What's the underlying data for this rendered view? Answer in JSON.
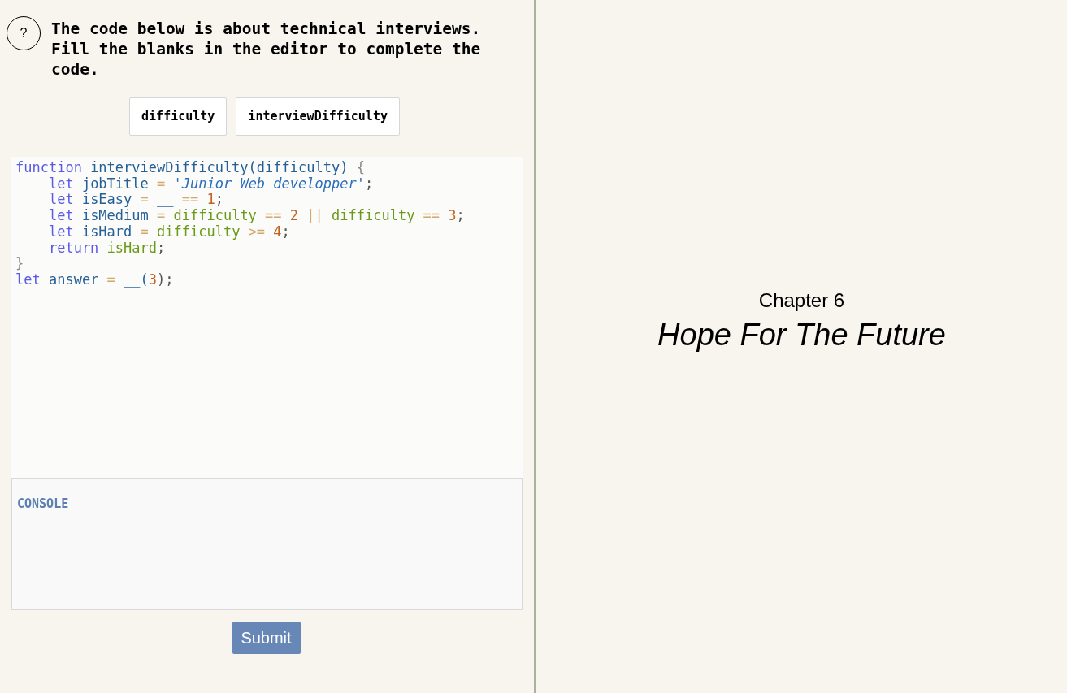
{
  "question": {
    "help_icon": "?",
    "text": "The code below is about technical interviews. Fill the blanks in the editor to complete the code."
  },
  "choices": [
    "difficulty",
    "interviewDifficulty"
  ],
  "code_lines": [
    {
      "tokens": [
        {
          "text": "function",
          "kind": "keyword"
        },
        {
          "text": " interviewDifficulty",
          "kind": "def"
        },
        {
          "text": "(difficulty) ",
          "kind": "def"
        },
        {
          "text": "{",
          "kind": "bracket"
        }
      ]
    },
    {
      "tokens": [
        {
          "text": "    let",
          "kind": "keyword"
        },
        {
          "text": " jobTitle ",
          "kind": "def"
        },
        {
          "text": "=",
          "kind": "operator"
        },
        {
          "text": " '",
          "kind": "string"
        },
        {
          "text": "Junior Web developper",
          "kind": "string-italic"
        },
        {
          "text": "'",
          "kind": "string"
        },
        {
          "text": ";",
          "kind": "punct"
        }
      ]
    },
    {
      "tokens": [
        {
          "text": "    let",
          "kind": "keyword"
        },
        {
          "text": " isEasy ",
          "kind": "def"
        },
        {
          "text": "=",
          "kind": "operator"
        },
        {
          "text": " __",
          "kind": "blank"
        },
        {
          "text": " ==",
          "kind": "operator"
        },
        {
          "text": " 1",
          "kind": "number"
        },
        {
          "text": ";",
          "kind": "punct"
        }
      ]
    },
    {
      "tokens": [
        {
          "text": "    let",
          "kind": "keyword"
        },
        {
          "text": " isMedium ",
          "kind": "def"
        },
        {
          "text": "=",
          "kind": "operator"
        },
        {
          "text": " difficulty",
          "kind": "variable"
        },
        {
          "text": " ==",
          "kind": "operator"
        },
        {
          "text": " 2",
          "kind": "number"
        },
        {
          "text": " ||",
          "kind": "operator"
        },
        {
          "text": " difficulty",
          "kind": "variable"
        },
        {
          "text": " ==",
          "kind": "operator"
        },
        {
          "text": " 3",
          "kind": "number"
        },
        {
          "text": ";",
          "kind": "punct"
        }
      ]
    },
    {
      "tokens": [
        {
          "text": "    let",
          "kind": "keyword"
        },
        {
          "text": " isHard ",
          "kind": "def"
        },
        {
          "text": "=",
          "kind": "operator"
        },
        {
          "text": " difficulty",
          "kind": "variable"
        },
        {
          "text": " >=",
          "kind": "operator"
        },
        {
          "text": " 4",
          "kind": "number"
        },
        {
          "text": ";",
          "kind": "punct"
        }
      ]
    },
    {
      "tokens": [
        {
          "text": "    return",
          "kind": "keyword"
        },
        {
          "text": " isHard",
          "kind": "variable"
        },
        {
          "text": ";",
          "kind": "punct"
        }
      ]
    },
    {
      "tokens": [
        {
          "text": "}",
          "kind": "bracket"
        }
      ]
    },
    {
      "tokens": [
        {
          "text": "let",
          "kind": "keyword"
        },
        {
          "text": " answer ",
          "kind": "def"
        },
        {
          "text": "=",
          "kind": "operator"
        },
        {
          "text": " __(",
          "kind": "blank"
        },
        {
          "text": "3",
          "kind": "number"
        },
        {
          "text": ");",
          "kind": "punct"
        }
      ]
    }
  ],
  "console": {
    "label": "CONSOLE"
  },
  "submit_button": "Submit",
  "chapter": {
    "number": "Chapter 6",
    "title": "Hope For The Future"
  }
}
